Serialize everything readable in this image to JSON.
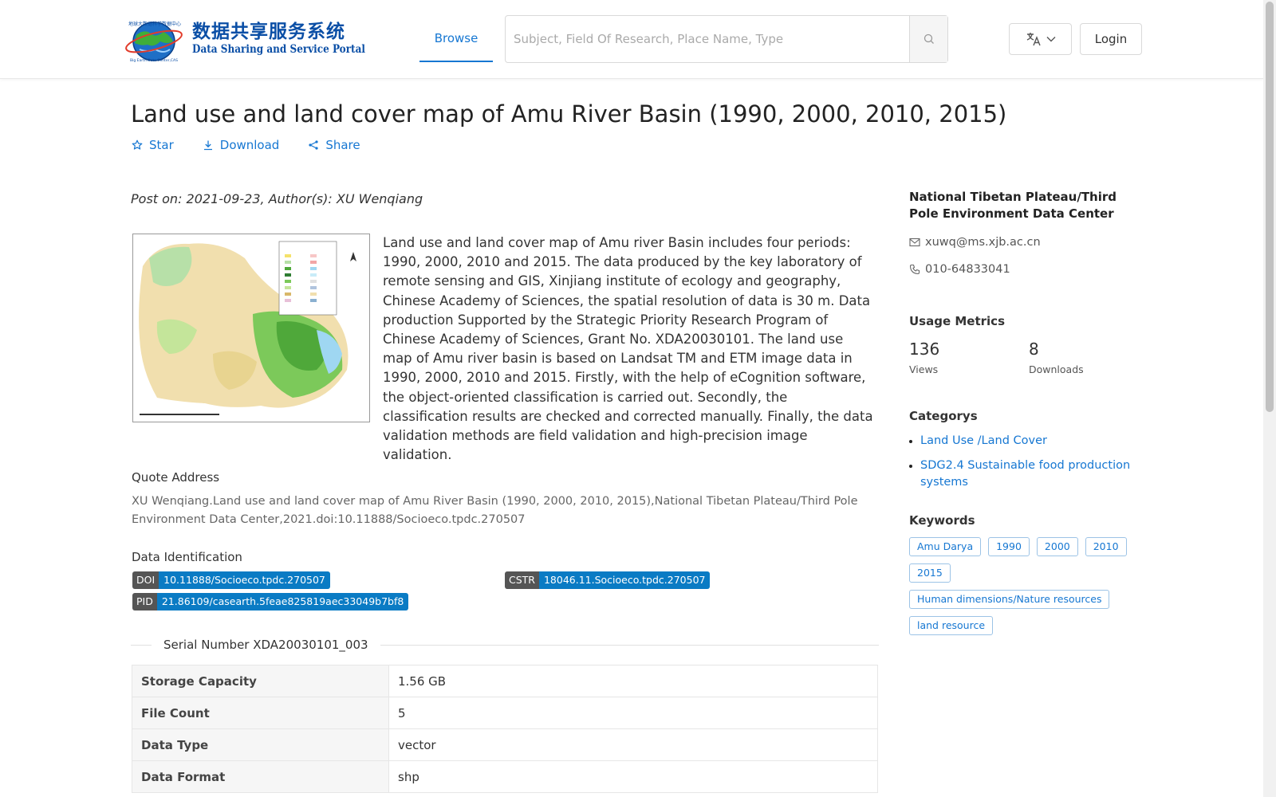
{
  "header": {
    "logo_cn": "数据共享服务系统",
    "logo_en": "Data Sharing and Service Portal",
    "logo_tagline": "地球大数据科学数据中心 Big Earth Data Center,CAS",
    "nav_browse": "Browse",
    "search_placeholder": "Subject, Field Of Research, Place Name, Type",
    "login": "Login"
  },
  "dataset": {
    "title": "Land use and land cover map of Amu River Basin (1990, 2000, 2010, 2015)",
    "actions": {
      "star": "Star",
      "download": "Download",
      "share": "Share"
    },
    "posted": "Post on: 2021-09-23, Author(s): XU Wenqiang",
    "description": "Land use and land cover map of Amu river Basin includes four periods: 1990, 2000, 2010 and 2015. The data produced by the key laboratory of remote sensing and GIS, Xinjiang institute of ecology and geography, Chinese Academy of Sciences, the spatial resolution of data is 30 m. Data production Supported by the Strategic Priority Research Program of Chinese Academy of Sciences, Grant No. XDA20030101. The land use map of Amu river basin is based on Landsat TM and ETM image data in 1990, 2000, 2010 and 2015. Firstly, with the help of eCognition software, the object-oriented classification is carried out. Secondly, the classification results are checked and corrected manually. Finally, the data validation methods are field validation and high-precision image validation.",
    "quote_label": "Quote Address",
    "quote": "XU Wenqiang.Land use and land cover map of Amu River Basin (1990, 2000, 2010, 2015),National Tibetan Plateau/Third Pole Environment Data Center,2021.doi:10.11888/Socioeco.tpdc.270507",
    "identification_label": "Data Identification",
    "identifiers": {
      "doi_key": "DOI",
      "doi": "10.11888/Socioeco.tpdc.270507",
      "cstr_key": "CSTR",
      "cstr": "18046.11.Socioeco.tpdc.270507",
      "pid_key": "PID",
      "pid": "21.86109/casearth.5feae825819aec33049b7bf8"
    },
    "serial": "Serial Number XDA20030101_003",
    "table": [
      {
        "key": "Storage Capacity",
        "value": "1.56 GB"
      },
      {
        "key": "File Count",
        "value": "5"
      },
      {
        "key": "Data Type",
        "value": "vector"
      },
      {
        "key": "Data Format",
        "value": "shp"
      }
    ]
  },
  "sidebar": {
    "org": "National Tibetan Plateau/Third Pole Environment Data Center",
    "email": "xuwq@ms.xjb.ac.cn",
    "phone": "010-64833041",
    "usage_title": "Usage Metrics",
    "views": "136",
    "views_label": "Views",
    "downloads": "8",
    "downloads_label": "Downloads",
    "categories_title": "Categorys",
    "categories": [
      "Land Use /Land Cover",
      "SDG2.4 Sustainable food production systems"
    ],
    "keywords_title": "Keywords",
    "keywords": [
      "Amu Darya",
      "1990",
      "2000",
      "2010",
      "2015",
      "Human dimensions/Nature resources",
      "land resource"
    ]
  },
  "colors": {
    "accent": "#1677d2",
    "badge_key": "#555555",
    "badge_value": "#0a7bc4"
  },
  "icons": [
    "star-icon",
    "download-icon",
    "share-icon",
    "search-icon",
    "translate-icon",
    "chevron-down-icon",
    "mail-icon",
    "phone-icon"
  ]
}
